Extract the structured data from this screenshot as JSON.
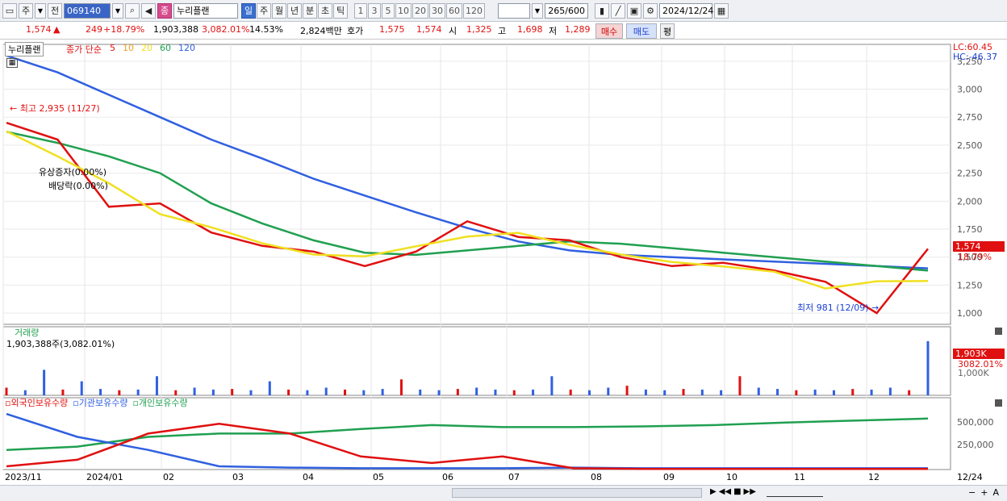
{
  "toolbar": {
    "period_left": "주",
    "adj_label": "전",
    "code": "069140",
    "stock_badge": "종",
    "stock_name": "누리플랜",
    "period_tabs": [
      {
        "label": "일",
        "selected": true
      },
      {
        "label": "주",
        "selected": false
      },
      {
        "label": "월",
        "selected": false
      },
      {
        "label": "년",
        "selected": false
      },
      {
        "label": "분",
        "selected": false
      },
      {
        "label": "초",
        "selected": false
      },
      {
        "label": "틱",
        "selected": false
      }
    ],
    "num_tabs": [
      "1",
      "3",
      "5",
      "10",
      "20",
      "30",
      "60",
      "120"
    ],
    "count_current": "265",
    "count_total": "/600",
    "date": "2024/12/24"
  },
  "quote": {
    "price": "1,574",
    "up_arrow": "▲",
    "change": "249",
    "change_pct": "+18.79%",
    "volume": "1,903,388",
    "volume_pct": "3,082.01%",
    "turnover": "14.53%",
    "amount": "2,824백만",
    "hoga_label": "호가",
    "hoga_ask": "1,575",
    "hoga_bid": "1,574",
    "open_label": "시",
    "open": "1,325",
    "high_label": "고",
    "high": "1,698",
    "low_label": "저",
    "low": "1,289",
    "buy_btn": "매수",
    "sell_btn": "매도",
    "extra_btn": "평"
  },
  "price_panel": {
    "stock_label": "누리플랜",
    "ma_label": "종가 단순",
    "ma_periods": [
      "5",
      "10",
      "20",
      "60",
      "120"
    ],
    "ma_colors": [
      "#e01010",
      "#f0a020",
      "#f0e020",
      "#20a050",
      "#3060e0"
    ],
    "lc": "LC:60.45",
    "hc": "HC:-46.37",
    "y_ticks": [
      "3,250",
      "3,000",
      "2,750",
      "2,500",
      "2,250",
      "2,000",
      "1,750",
      "1,500",
      "1,250",
      "1,000"
    ],
    "current_price_tag": "1,574",
    "current_pct_tag": "18.79%",
    "high_annotation": "최고 2,935 (11/27)",
    "low_annotation": "최저 981 (12/09)",
    "event1": "유상증자(0.00%)",
    "event2": "배당락(0.00%)"
  },
  "volume_panel": {
    "title": "거래량",
    "value_label": "1,903,388주(3,082.01%)",
    "y_ticks": [
      "1,000K"
    ],
    "tag_value": "1,903K",
    "tag_pct": "3082.01%"
  },
  "holdings_panel": {
    "legend": [
      "외국인보유수량",
      "기관보유수량",
      "개인보유수량"
    ],
    "colors": [
      "#e01010",
      "#3060e0",
      "#20a050"
    ],
    "y_ticks": [
      "500,000",
      "250,000"
    ]
  },
  "x_axis": {
    "labels": [
      "2023/11",
      "2024/01",
      "02",
      "03",
      "04",
      "05",
      "06",
      "07",
      "08",
      "09",
      "10",
      "11",
      "12"
    ],
    "right_label": "12/24"
  },
  "chart_data": {
    "type": "line",
    "series": [
      {
        "name": "MA120",
        "values": [
          3300,
          3150,
          2950,
          2750,
          2550,
          2380,
          2200,
          2050,
          1900,
          1760,
          1640,
          1560,
          1520,
          1500,
          1480,
          1460,
          1440,
          1420,
          1400
        ]
      },
      {
        "name": "MA60",
        "values": [
          2620,
          2520,
          2400,
          2250,
          1980,
          1800,
          1650,
          1540,
          1520,
          1560,
          1600,
          1640,
          1620,
          1580,
          1540,
          1500,
          1460,
          1420,
          1380
        ]
      },
      {
        "name": "Close",
        "values": [
          2700,
          2550,
          1950,
          1980,
          1720,
          1600,
          1550,
          1420,
          1550,
          1820,
          1680,
          1650,
          1500,
          1420,
          1450,
          1380,
          1280,
          1000,
          1574
        ]
      }
    ],
    "ylim": [
      900,
      3400
    ],
    "x": [
      "2023/11",
      "2023/12",
      "2024/01",
      "2024/02a",
      "2024/02b",
      "2024/03",
      "2024/04",
      "2024/05a",
      "2024/05b",
      "2024/06",
      "2024/07",
      "2024/08a",
      "2024/08b",
      "2024/09",
      "2024/10",
      "2024/11",
      "2024/12a",
      "2024/12b",
      "2024/12/24"
    ]
  }
}
